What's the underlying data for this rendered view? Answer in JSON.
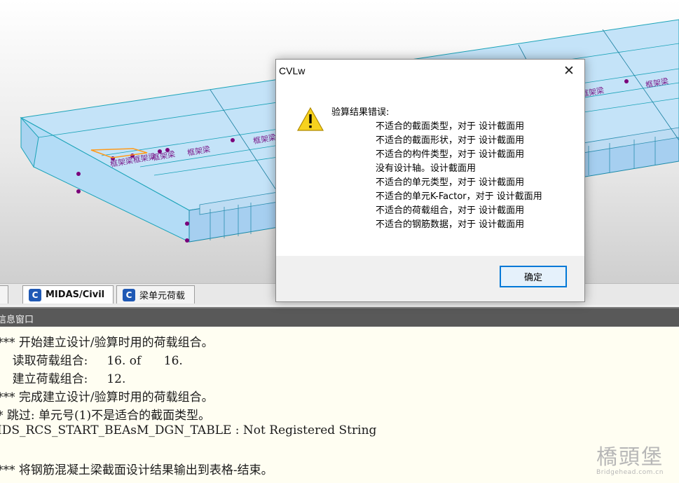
{
  "model_view": {
    "labels": [
      "框架梁",
      "框架梁",
      "框架梁框架梁",
      "框架梁",
      "框架梁",
      "框架梁"
    ]
  },
  "tabs": [
    {
      "label": "MIDAS/Civil",
      "icon": "midas-civil-icon",
      "active": true
    },
    {
      "label": "梁单元荷载",
      "icon": "midas-civil-icon",
      "active": false
    }
  ],
  "message_window": {
    "title": "信息窗口",
    "lines": [
      "*** 开始建立设计/验算时用的荷载组合。",
      "    读取荷载组合:     16. of      16.",
      "    建立荷载组合:     12.",
      "*** 完成建立设计/验算时用的荷载组合。",
      "* 跳过: 单元号(1)不是适合的截面类型。",
      "IDS_RCS_START_BEAsM_DGN_TABLE : Not Registered String",
      "",
      "*** 将钢筋混凝土梁截面设计结果输出到表格-结束。"
    ]
  },
  "dialog": {
    "title": "CVLw",
    "icon": "warning-icon",
    "heading": "验算结果错误:",
    "lines": [
      "不适合的截面类型，对于 设计截面用",
      "不适合的截面形状，对于 设计截面用",
      "不适合的构件类型，对于 设计截面用",
      "没有设计轴。设计截面用",
      "不适合的单元类型，对于 设计截面用",
      "不适合的单元K-Factor，对于 设计截面用",
      "不适合的荷载组合，对于 设计截面用",
      "不适合的钢筋数据，对于 设计截面用"
    ],
    "ok_label": "确定"
  },
  "watermark": {
    "main": "橋頭堡",
    "sub": "Bridgehead.com.cn"
  }
}
